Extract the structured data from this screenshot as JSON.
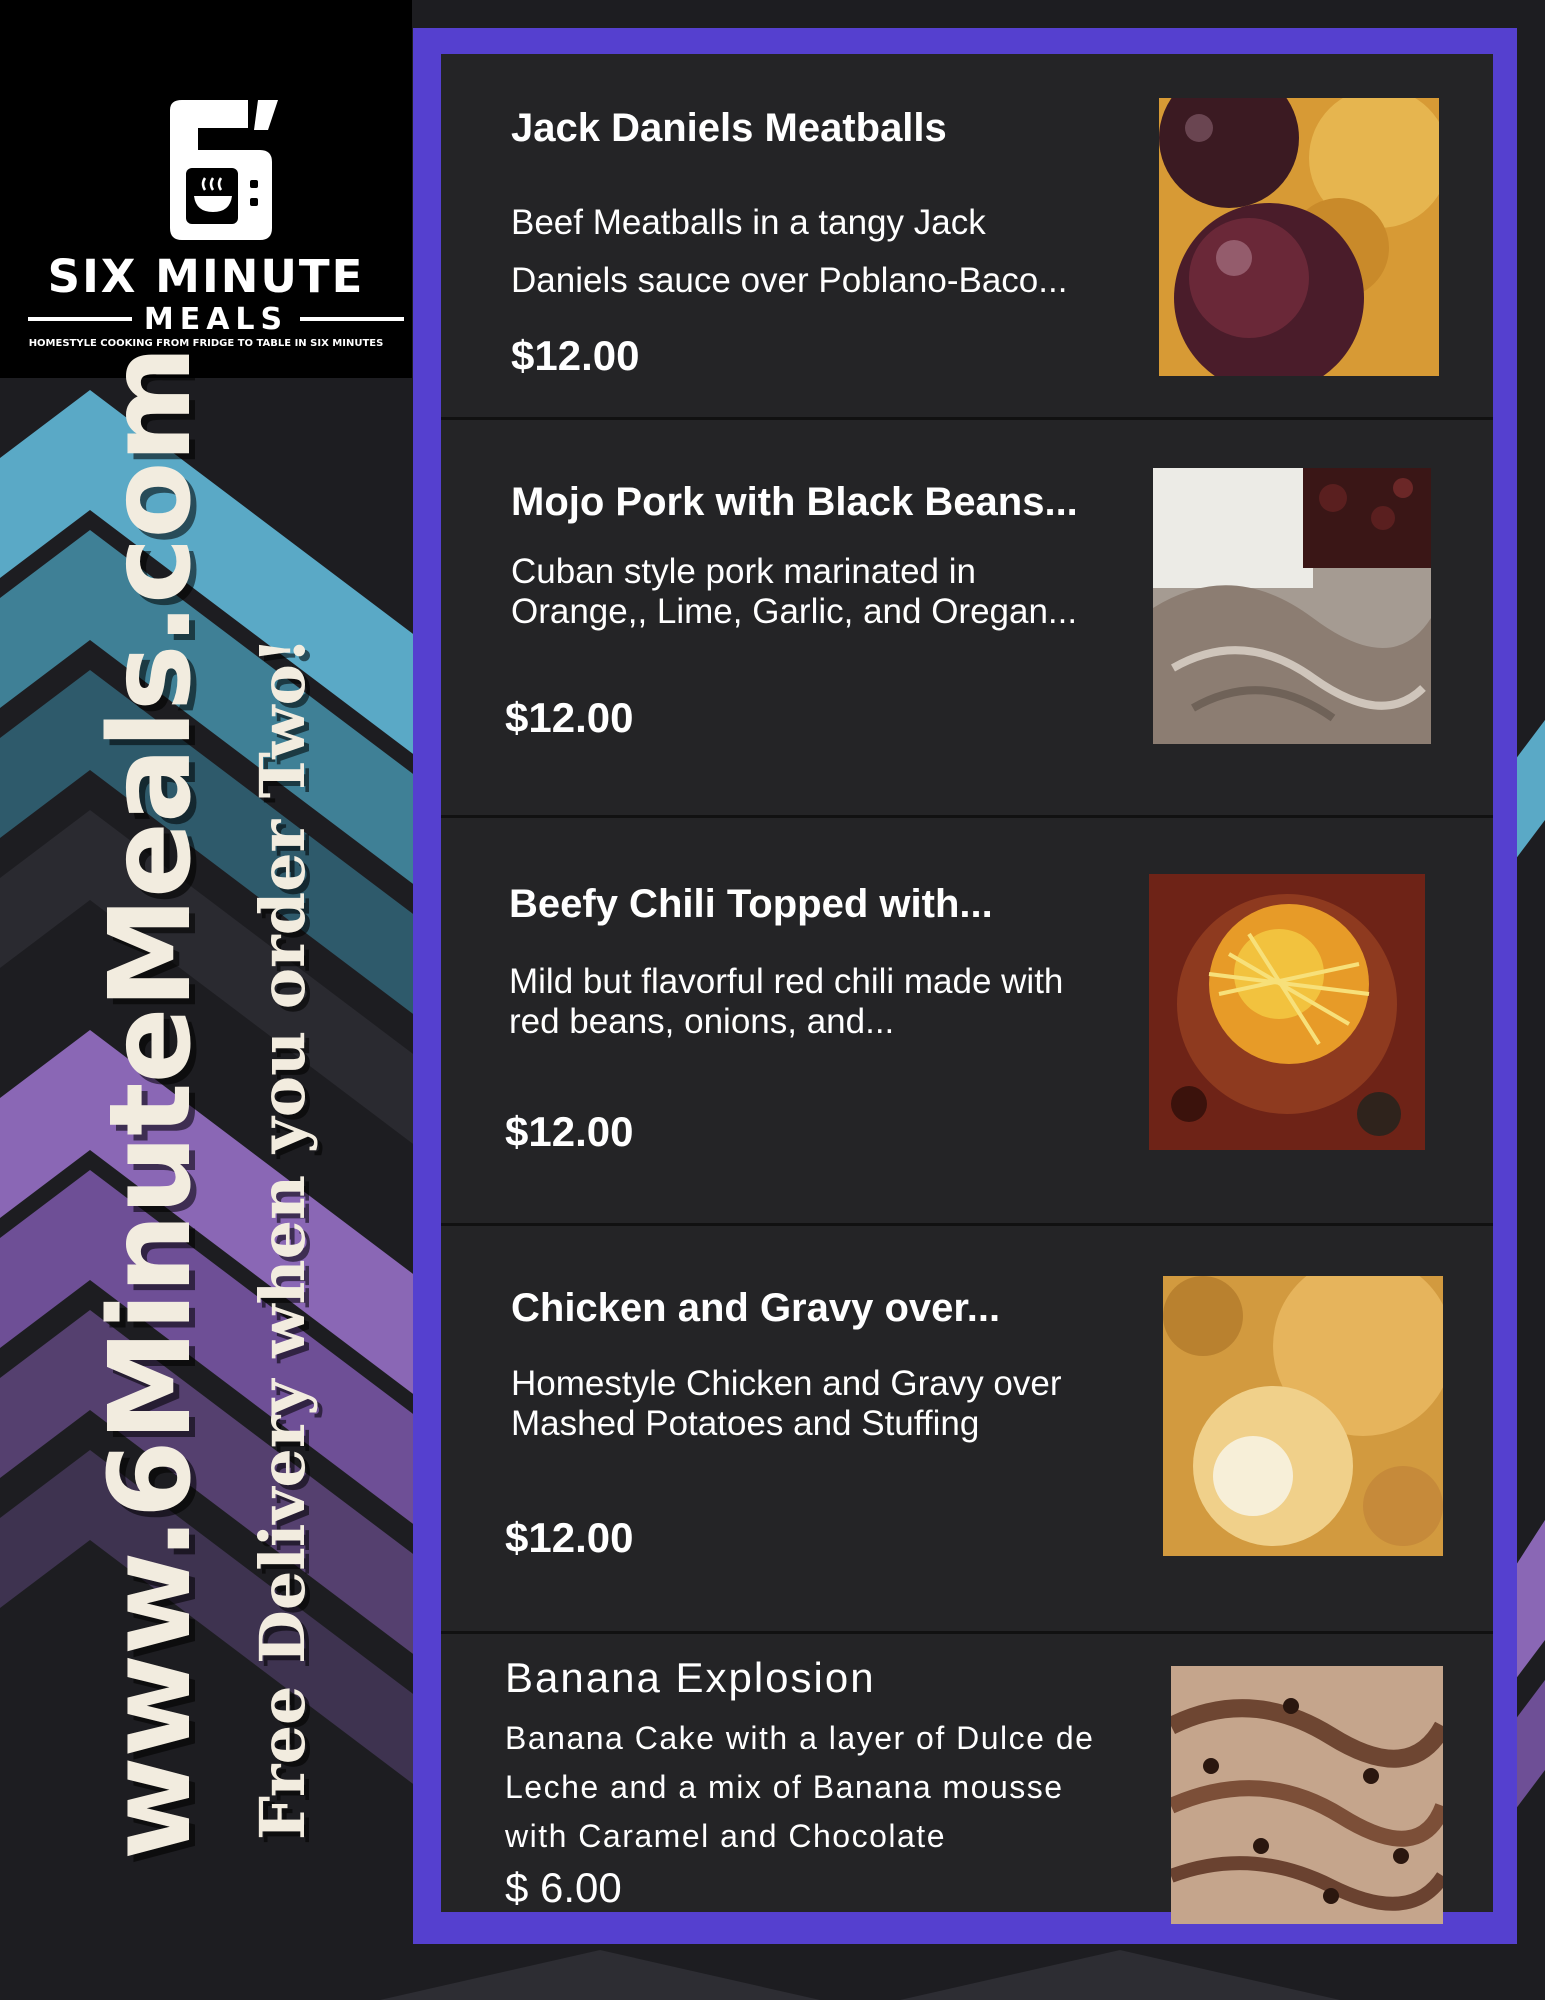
{
  "brand": {
    "name": "SIX MINUTE",
    "subname": "MEALS",
    "tagline": "HOMESTYLE COOKING FROM FRIDGE TO TABLE IN SIX MINUTES",
    "logo_icon": "microwave-bowl-logo"
  },
  "side": {
    "website": "www.6MinuteMeals.com",
    "promo": "Free Delivery when you order Two!"
  },
  "menu": {
    "items": [
      {
        "title": "Jack Daniels Meatballs",
        "desc": "Beef Meatballs in a tangy Jack Daniels sauce over Poblano-Baco...",
        "price": "$12.00"
      },
      {
        "title": "Mojo Pork with Black Beans...",
        "desc": "Cuban style pork marinated in Orange,, Lime, Garlic, and Oregan...",
        "price": "$12.00"
      },
      {
        "title": "Beefy Chili Topped with...",
        "desc": "Mild but flavorful red chili made with red beans, onions, and...",
        "price": "$12.00"
      },
      {
        "title": "Chicken and Gravy over...",
        "desc": "Homestyle Chicken and Gravy over Mashed Potatoes and Stuffing",
        "price": "$12.00"
      },
      {
        "title": "Banana Explosion",
        "desc": "Banana Cake with a layer of Dulce de Leche and a mix of Banana mousse with Caramel and Chocolate",
        "price": "$ 6.00"
      }
    ]
  },
  "colors": {
    "frame": "#5540cf",
    "panel": "#242426",
    "text": "#ffffff",
    "accent_blue": "#5aa9c6",
    "accent_purple": "#8a67b5"
  }
}
